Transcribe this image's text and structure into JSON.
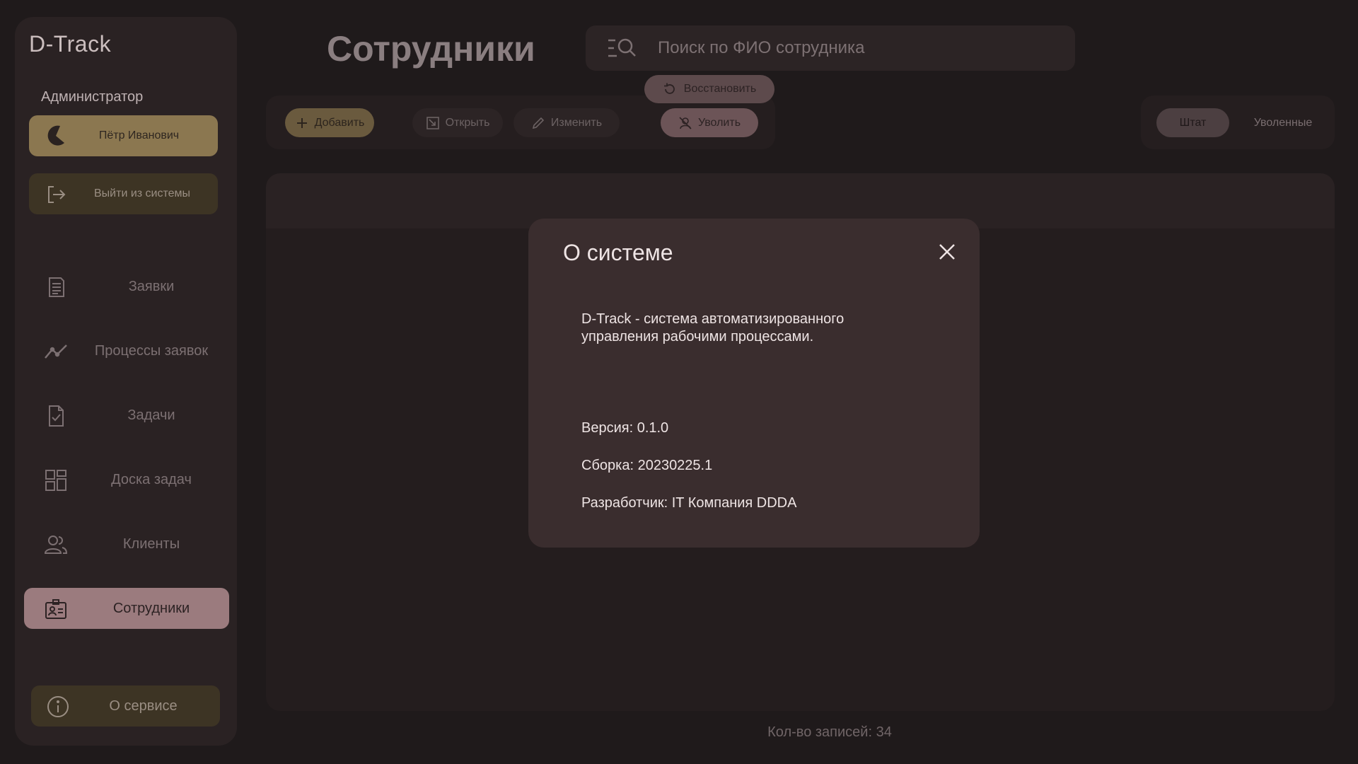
{
  "app": {
    "name": "D-Track"
  },
  "sidebar": {
    "role": "Администратор",
    "user_name": "Пётр Иванович",
    "logout_label": "Выйти из системы",
    "items": [
      {
        "label": "Заявки",
        "icon": "document-list-icon"
      },
      {
        "label": "Процессы заявок",
        "icon": "trend-line-icon"
      },
      {
        "label": "Задачи",
        "icon": "file-check-icon"
      },
      {
        "label": "Доска задач",
        "icon": "grid-board-icon"
      },
      {
        "label": "Клиенты",
        "icon": "users-icon"
      },
      {
        "label": "Сотрудники",
        "icon": "id-badge-icon",
        "active": true
      }
    ],
    "about_label": "О сервисе"
  },
  "header": {
    "title": "Сотрудники",
    "search_placeholder": "Поиск по ФИО сотрудника"
  },
  "toolbar": {
    "add_label": "Добавить",
    "open_label": "Открыть",
    "edit_label": "Изменить",
    "fire_label": "Уволить",
    "restore_label": "Восстановить"
  },
  "filters": {
    "staff_label": "Штат",
    "fired_label": "Уволенные",
    "selected": "Штат"
  },
  "footer": {
    "records_label": "Кол-во записей: 34"
  },
  "modal": {
    "title": "О системе",
    "description": "D-Track - система автоматизированного управления рабочими процессами.",
    "version": "Версия: 0.1.0",
    "build": "Сборка: 20230225.1",
    "developer": "Разработчик: IT Компания DDDA"
  },
  "colors": {
    "background": "#1f1a1b",
    "sidebar": "#2a2223",
    "accent_gold": "#8b7750",
    "accent_rose": "#9b7b7e",
    "modal": "#3a2d2e"
  }
}
